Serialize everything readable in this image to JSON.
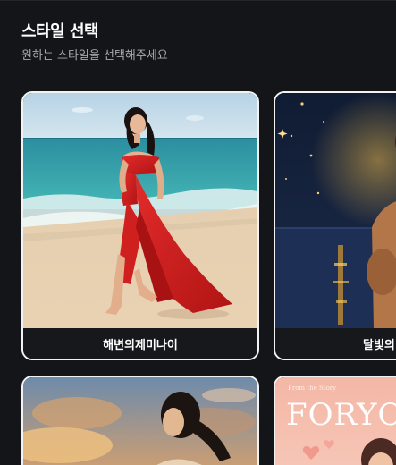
{
  "header": {
    "title": "스타일 선택",
    "subtitle": "원하는 스타일을 선택해주세요"
  },
  "styles": [
    {
      "label": "해변의제미나이",
      "selected": true
    },
    {
      "label": "달빛의"
    },
    {
      "label": ""
    },
    {
      "label": "",
      "cover_title": "FORYOU",
      "cover_small": "From the Story"
    }
  ],
  "colors": {
    "background": "#141519",
    "card_border": "#f2f2f2",
    "text_secondary": "#a6a9b0"
  }
}
